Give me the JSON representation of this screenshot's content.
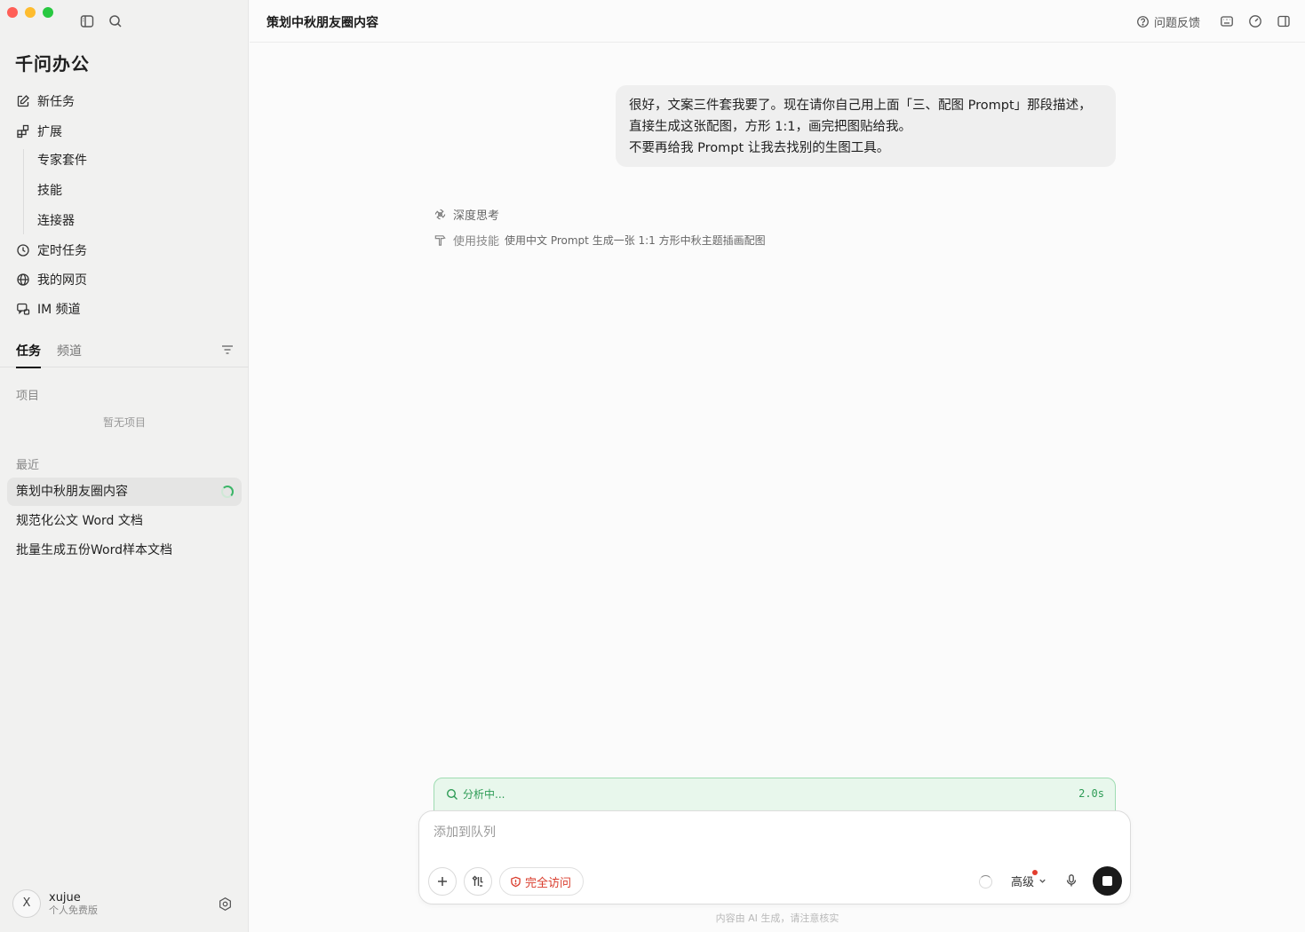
{
  "sidebar": {
    "brand": "千问办公",
    "nav": {
      "new_task": "新任务",
      "extensions": "扩展",
      "expert_kits": "专家套件",
      "skills": "技能",
      "connectors": "连接器",
      "scheduled_tasks": "定时任务",
      "my_webpages": "我的网页",
      "im_channels": "IM 频道"
    },
    "tabs": {
      "tasks": "任务",
      "channels": "频道"
    },
    "projects_label": "项目",
    "projects_empty": "暂无项目",
    "recent_label": "最近",
    "recent": [
      {
        "title": "策划中秋朋友圈内容"
      },
      {
        "title": "规范化公文 Word 文档"
      },
      {
        "title": "批量生成五份Word样本文档"
      }
    ],
    "user": {
      "initial": "X",
      "name": "xujue",
      "plan": "个人免费版"
    }
  },
  "header": {
    "title": "策划中秋朋友圈内容",
    "feedback": "问题反馈"
  },
  "conversation": {
    "user_message_lines": [
      "很好，文案三件套我要了。现在请你自己用上面「三、配图 Prompt」那段描述，",
      "直接生成这张配图，方形 1:1，画完把图贴给我。",
      "不要再给我 Prompt 让我去找别的生图工具。"
    ],
    "thinking_label": "深度思考",
    "skill_label": "使用技能",
    "skill_detail": "使用中文 Prompt 生成一张 1:1 方形中秋主题插画配图"
  },
  "status": {
    "text": "分析中...",
    "elapsed": "2.0s"
  },
  "composer": {
    "placeholder": "添加到队列",
    "access_label": "完全访问",
    "mode_label": "高级"
  },
  "footer": {
    "disclaimer": "内容由 AI 生成，请注意核实"
  },
  "colors": {
    "accent_green": "#2d9b55",
    "access_red": "#d93b2b"
  }
}
